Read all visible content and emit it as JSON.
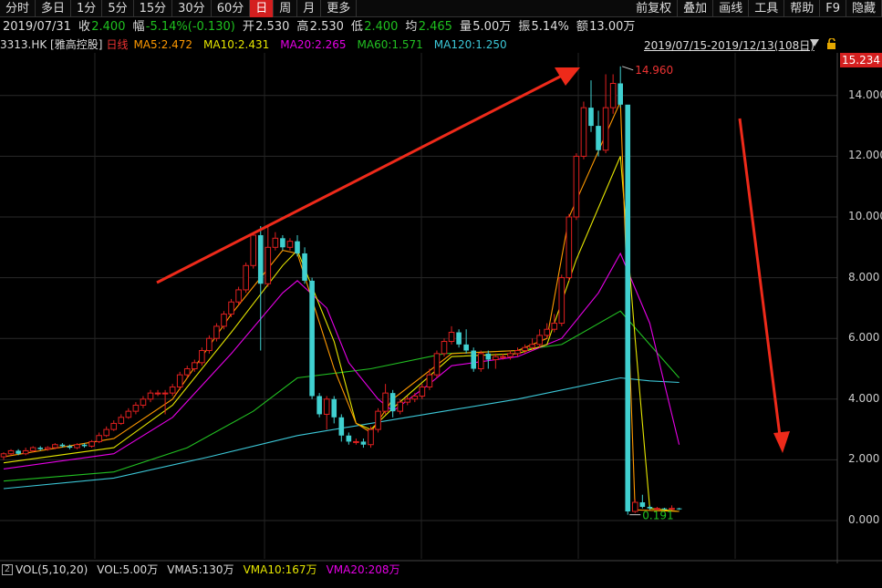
{
  "toolbar": {
    "left": [
      "分时",
      "多日",
      "1分",
      "5分",
      "15分",
      "30分",
      "60分",
      "日",
      "周",
      "月",
      "更多"
    ],
    "right": [
      "前复权",
      "叠加",
      "画线",
      "工具",
      "帮助",
      "F9",
      "隐藏"
    ],
    "active": "日"
  },
  "info": {
    "date": "2019/07/31",
    "close_label": "收",
    "close": "2.400",
    "change_label": "幅",
    "change": "-5.14%(-0.130)",
    "open_label": "开",
    "open": "2.530",
    "high_label": "高",
    "high": "2.530",
    "low_label": "低",
    "low": "2.400",
    "avg_label": "均",
    "avg": "2.465",
    "vol_label": "量",
    "vol": "5.00万",
    "amp_label": "振",
    "amp": "5.14%",
    "amt_label": "额",
    "amt": "13.00万"
  },
  "ma": {
    "code": "3313.HK [雅高控股]",
    "period": "日线",
    "ma5": "MA5:2.472",
    "ma10": "MA10:2.431",
    "ma20": "MA20:2.265",
    "ma60": "MA60:1.571",
    "ma120": "MA120:1.250",
    "date_range": "2019/07/15-2019/12/13(108日)"
  },
  "price_box": "15.234",
  "y_axis": [
    "14.000",
    "12.000",
    "10.000",
    "8.000",
    "6.000",
    "4.000",
    "2.000",
    "0.000"
  ],
  "annotations": {
    "high": "14.960",
    "low": "0.191"
  },
  "vol": {
    "icon": "2",
    "title": "VOL(5,10,20)",
    "vol": "VOL:5.00万",
    "vma5": "VMA5:130万",
    "vma10": "VMA10:167万",
    "vma20": "VMA20:208万"
  },
  "colors": {
    "up": "#e02020",
    "down": "#40d0d0",
    "accent": "#d41f1f",
    "arrow": "#ee2a1a"
  },
  "chart_data": {
    "type": "candlestick",
    "ylim": [
      -0.5,
      15.5
    ],
    "yticks": [
      14,
      12,
      10,
      8,
      6,
      4,
      2,
      0
    ],
    "candles": [
      [
        2.1,
        2.2,
        2.0,
        2.25
      ],
      [
        2.2,
        2.3,
        2.15,
        2.35
      ],
      [
        2.3,
        2.2,
        2.15,
        2.35
      ],
      [
        2.2,
        2.3,
        2.15,
        2.4
      ],
      [
        2.3,
        2.4,
        2.25,
        2.45
      ],
      [
        2.4,
        2.35,
        2.3,
        2.45
      ],
      [
        2.35,
        2.4,
        2.3,
        2.45
      ],
      [
        2.4,
        2.5,
        2.35,
        2.55
      ],
      [
        2.5,
        2.45,
        2.4,
        2.55
      ],
      [
        2.45,
        2.4,
        2.35,
        2.5
      ],
      [
        2.4,
        2.5,
        2.35,
        2.55
      ],
      [
        2.5,
        2.45,
        2.4,
        2.55
      ],
      [
        2.45,
        2.6,
        2.4,
        2.65
      ],
      [
        2.6,
        2.8,
        2.55,
        2.9
      ],
      [
        2.8,
        3.0,
        2.75,
        3.1
      ],
      [
        3.0,
        3.2,
        2.95,
        3.3
      ],
      [
        3.2,
        3.4,
        3.15,
        3.5
      ],
      [
        3.4,
        3.6,
        3.35,
        3.7
      ],
      [
        3.6,
        3.8,
        3.5,
        3.9
      ],
      [
        3.8,
        4.0,
        3.7,
        4.1
      ],
      [
        4.0,
        4.2,
        3.9,
        4.3
      ],
      [
        4.2,
        4.2,
        4.1,
        4.3
      ],
      [
        4.2,
        4.2,
        3.5,
        4.3
      ],
      [
        4.2,
        4.4,
        4.1,
        4.5
      ],
      [
        4.4,
        4.8,
        4.3,
        4.9
      ],
      [
        4.8,
        5.0,
        4.7,
        5.1
      ],
      [
        5.0,
        5.2,
        4.9,
        5.3
      ],
      [
        5.2,
        5.6,
        5.1,
        5.7
      ],
      [
        5.6,
        6.0,
        5.5,
        6.1
      ],
      [
        6.0,
        6.4,
        5.9,
        6.5
      ],
      [
        6.4,
        6.8,
        6.3,
        6.9
      ],
      [
        6.8,
        7.2,
        6.7,
        7.3
      ],
      [
        7.2,
        7.6,
        7.1,
        7.7
      ],
      [
        7.6,
        8.4,
        7.5,
        8.5
      ],
      [
        8.4,
        9.4,
        8.3,
        9.5
      ],
      [
        9.4,
        7.8,
        5.6,
        9.7
      ],
      [
        7.8,
        9.0,
        7.7,
        9.7
      ],
      [
        9.0,
        9.3,
        8.9,
        9.5
      ],
      [
        9.3,
        9.0,
        8.9,
        9.4
      ],
      [
        9.0,
        9.2,
        8.9,
        9.3
      ],
      [
        9.2,
        8.8,
        8.7,
        9.4
      ],
      [
        8.8,
        7.9,
        7.8,
        9.0
      ],
      [
        7.9,
        4.1,
        4.0,
        8.0
      ],
      [
        4.1,
        3.5,
        3.4,
        4.2
      ],
      [
        3.5,
        4.0,
        3.0,
        4.1
      ],
      [
        4.0,
        3.4,
        3.2,
        4.1
      ],
      [
        3.4,
        2.8,
        2.6,
        3.5
      ],
      [
        2.8,
        2.6,
        2.5,
        2.9
      ],
      [
        2.6,
        2.6,
        2.5,
        2.7
      ],
      [
        2.6,
        2.5,
        2.4,
        2.7
      ],
      [
        2.5,
        3.0,
        2.4,
        3.1
      ],
      [
        3.0,
        3.6,
        2.9,
        3.7
      ],
      [
        3.6,
        4.2,
        3.5,
        4.5
      ],
      [
        4.2,
        3.6,
        3.4,
        4.3
      ],
      [
        3.6,
        3.9,
        3.5,
        4.0
      ],
      [
        3.9,
        4.0,
        3.8,
        4.1
      ],
      [
        4.0,
        4.1,
        3.9,
        4.2
      ],
      [
        4.1,
        4.4,
        4.0,
        4.5
      ],
      [
        4.4,
        4.8,
        4.3,
        5.0
      ],
      [
        4.8,
        5.5,
        4.7,
        5.6
      ],
      [
        5.5,
        5.9,
        5.4,
        6.0
      ],
      [
        5.9,
        6.2,
        5.8,
        6.4
      ],
      [
        6.2,
        5.8,
        5.7,
        6.3
      ],
      [
        5.8,
        5.6,
        5.5,
        6.3
      ],
      [
        5.6,
        5.0,
        4.9,
        5.7
      ],
      [
        5.0,
        5.5,
        4.9,
        5.6
      ],
      [
        5.5,
        5.3,
        5.0,
        5.6
      ],
      [
        5.3,
        5.4,
        5.0,
        5.5
      ],
      [
        5.4,
        5.4,
        5.3,
        5.5
      ],
      [
        5.4,
        5.5,
        5.3,
        5.6
      ],
      [
        5.5,
        5.6,
        5.4,
        5.7
      ],
      [
        5.6,
        5.7,
        5.5,
        5.8
      ],
      [
        5.7,
        5.8,
        5.6,
        6.0
      ],
      [
        5.8,
        6.1,
        5.7,
        6.3
      ],
      [
        6.1,
        6.3,
        6.0,
        6.5
      ],
      [
        6.3,
        6.5,
        6.2,
        6.8
      ],
      [
        6.5,
        8.0,
        6.4,
        8.1
      ],
      [
        8.0,
        10.0,
        7.9,
        10.1
      ],
      [
        10.0,
        12.0,
        9.9,
        12.1
      ],
      [
        12.0,
        13.6,
        11.9,
        13.8
      ],
      [
        13.6,
        13.0,
        12.8,
        14.5
      ],
      [
        13.0,
        12.2,
        12.0,
        13.5
      ],
      [
        12.2,
        13.6,
        12.1,
        14.7
      ],
      [
        13.6,
        14.4,
        13.4,
        14.7
      ],
      [
        14.4,
        13.7,
        13.6,
        14.96
      ],
      [
        13.7,
        0.3,
        0.191,
        5.7
      ],
      [
        0.3,
        0.6,
        0.25,
        0.7
      ],
      [
        0.6,
        0.45,
        0.4,
        0.85
      ],
      [
        0.45,
        0.4,
        0.35,
        0.5
      ],
      [
        0.4,
        0.4,
        0.35,
        0.45
      ],
      [
        0.4,
        0.38,
        0.35,
        0.42
      ],
      [
        0.38,
        0.4,
        0.35,
        0.5
      ],
      [
        0.4,
        0.38,
        0.35,
        0.42
      ]
    ],
    "ma5": [
      [
        2.1,
        0
      ],
      [
        2.7,
        15
      ],
      [
        4.0,
        23
      ],
      [
        6.8,
        31
      ],
      [
        8.9,
        38
      ],
      [
        8.8,
        40
      ],
      [
        5.0,
        45
      ],
      [
        3.2,
        48
      ],
      [
        2.9,
        50
      ],
      [
        4.0,
        53
      ],
      [
        5.5,
        61
      ],
      [
        5.6,
        70
      ],
      [
        6.0,
        74
      ],
      [
        10.0,
        77
      ],
      [
        13.8,
        84
      ],
      [
        0.35,
        86
      ],
      [
        0.3,
        92
      ]
    ],
    "ma10": [
      [
        1.9,
        0
      ],
      [
        2.4,
        15
      ],
      [
        3.8,
        23
      ],
      [
        6.2,
        31
      ],
      [
        8.4,
        38
      ],
      [
        8.9,
        40
      ],
      [
        5.9,
        45
      ],
      [
        3.2,
        48
      ],
      [
        3.0,
        50
      ],
      [
        3.7,
        53
      ],
      [
        5.4,
        61
      ],
      [
        5.5,
        70
      ],
      [
        5.8,
        74
      ],
      [
        8.6,
        78
      ],
      [
        12.0,
        84
      ],
      [
        6.0,
        86
      ],
      [
        0.4,
        88
      ],
      [
        0.3,
        92
      ]
    ],
    "ma20": [
      [
        1.7,
        0
      ],
      [
        2.2,
        15
      ],
      [
        3.4,
        23
      ],
      [
        5.5,
        31
      ],
      [
        7.5,
        38
      ],
      [
        7.9,
        40
      ],
      [
        7.0,
        44
      ],
      [
        5.2,
        47
      ],
      [
        4.0,
        51
      ],
      [
        3.6,
        53
      ],
      [
        4.5,
        58
      ],
      [
        5.1,
        61
      ],
      [
        5.4,
        70
      ],
      [
        6.0,
        76
      ],
      [
        7.5,
        81
      ],
      [
        8.8,
        84
      ],
      [
        6.5,
        88
      ],
      [
        2.5,
        92
      ]
    ],
    "ma60": [
      [
        1.3,
        0
      ],
      [
        1.6,
        15
      ],
      [
        2.4,
        25
      ],
      [
        3.6,
        34
      ],
      [
        4.7,
        40
      ],
      [
        5.0,
        50
      ],
      [
        5.5,
        60
      ],
      [
        5.6,
        70
      ],
      [
        5.8,
        76
      ],
      [
        6.9,
        84
      ],
      [
        5.8,
        88
      ],
      [
        4.7,
        92
      ]
    ],
    "ma120": [
      [
        1.05,
        0
      ],
      [
        1.4,
        15
      ],
      [
        2.1,
        28
      ],
      [
        2.8,
        40
      ],
      [
        3.2,
        50
      ],
      [
        3.6,
        60
      ],
      [
        4.0,
        70
      ],
      [
        4.7,
        84
      ],
      [
        4.6,
        88
      ],
      [
        4.55,
        92
      ]
    ]
  }
}
